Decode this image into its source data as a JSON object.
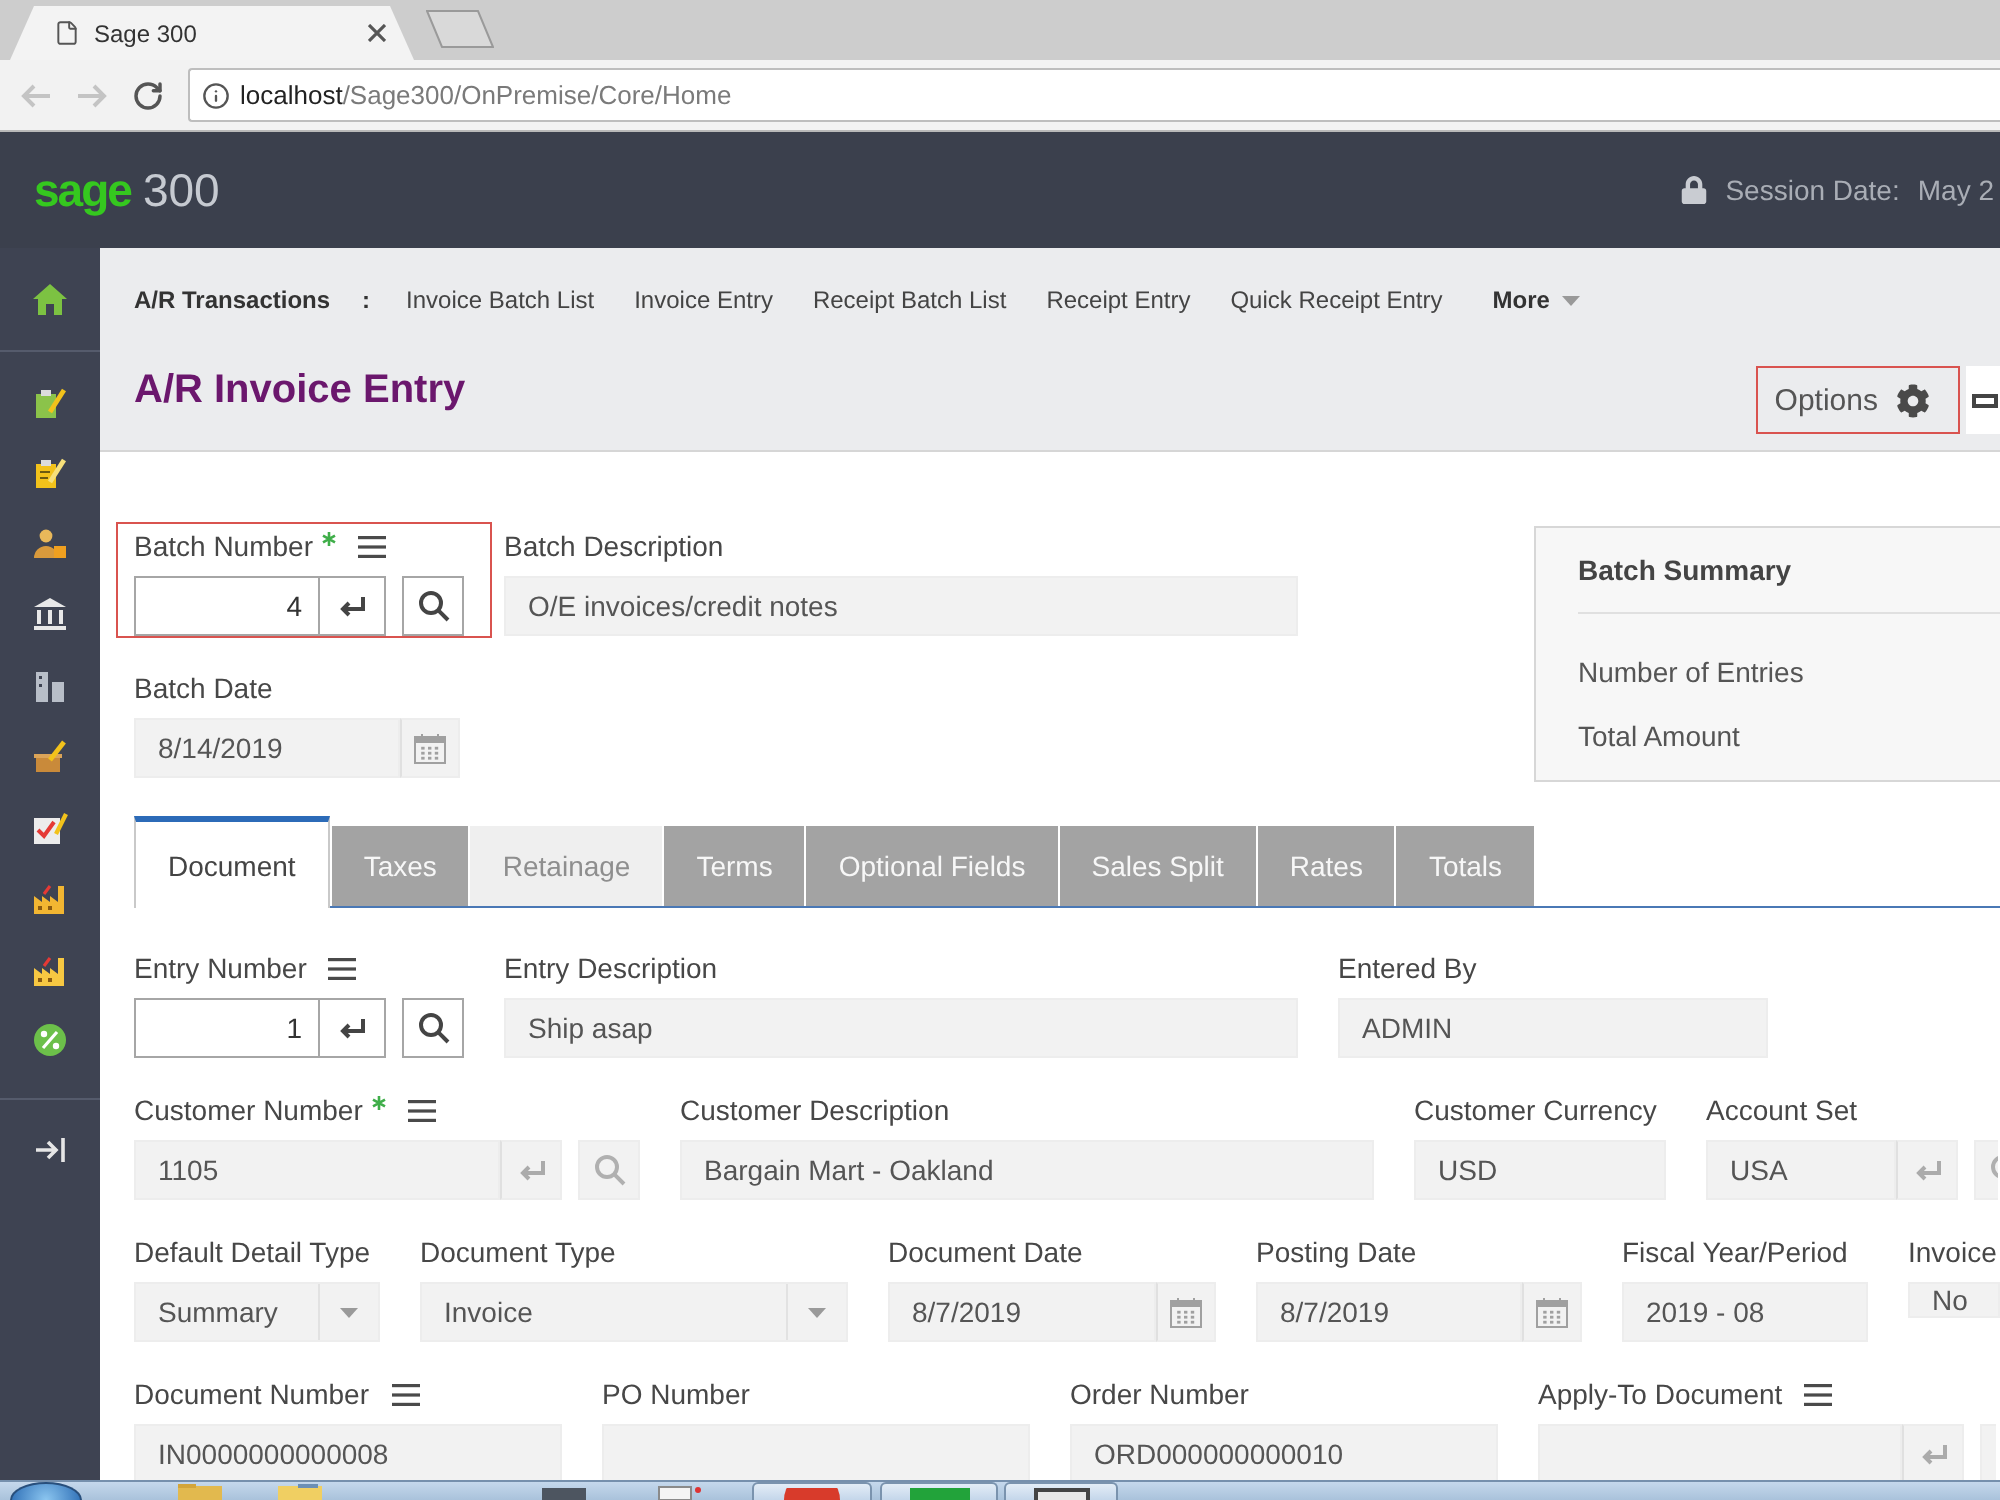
{
  "browser": {
    "tab_title": "Sage 300",
    "back_disabled": true,
    "forward_disabled": true,
    "url_host": "localhost",
    "url_path": "/Sage300/OnPremise/Core/Home"
  },
  "header": {
    "brand": "sage",
    "product": "300",
    "session_label": "Session Date:",
    "session_value": "May 2"
  },
  "breadcrumb": {
    "module": "A/R Transactions",
    "separator": ":",
    "links": [
      "Invoice Batch List",
      "Invoice Entry",
      "Receipt Batch List",
      "Receipt Entry",
      "Quick Receipt Entry"
    ],
    "more": "More"
  },
  "page_title": "A/R Invoice Entry",
  "options_button": {
    "label": "Options",
    "highlighted": true
  },
  "batch": {
    "fields": [
      {
        "kind": "lookup",
        "label": "Batch Number",
        "required": true,
        "menu": true,
        "disabled": false,
        "highlighted": true,
        "value": "4"
      },
      {
        "kind": "text",
        "label": "Batch Description",
        "required": false,
        "menu": false,
        "disabled": true,
        "highlighted": false,
        "value": "O/E invoices/credit notes"
      },
      {
        "kind": "date",
        "label": "Batch Date",
        "required": false,
        "menu": false,
        "disabled": true,
        "highlighted": false,
        "value": "8/14/2019"
      }
    ],
    "summary": {
      "title": "Batch Summary",
      "rows": [
        "Number of Entries",
        "Total Amount"
      ]
    }
  },
  "tabs": [
    {
      "label": "Document",
      "selected": true,
      "disabled": false
    },
    {
      "label": "Taxes",
      "selected": false,
      "disabled": false
    },
    {
      "label": "Retainage",
      "selected": false,
      "disabled": true
    },
    {
      "label": "Terms",
      "selected": false,
      "disabled": false
    },
    {
      "label": "Optional Fields",
      "selected": false,
      "disabled": false
    },
    {
      "label": "Sales Split",
      "selected": false,
      "disabled": false
    },
    {
      "label": "Rates",
      "selected": false,
      "disabled": false
    },
    {
      "label": "Totals",
      "selected": false,
      "disabled": false
    }
  ],
  "document_rows": [
    {
      "fields": [
        {
          "kind": "lookup",
          "label": "Entry Number",
          "required": false,
          "menu": true,
          "disabled": false,
          "value": "1"
        },
        {
          "kind": "text",
          "label": "Entry Description",
          "required": false,
          "menu": false,
          "disabled": true,
          "value": "Ship asap"
        },
        {
          "kind": "text",
          "label": "Entered By",
          "required": false,
          "menu": false,
          "disabled": true,
          "value": "ADMIN"
        }
      ]
    },
    {
      "fields": [
        {
          "kind": "lookup",
          "label": "Customer Number",
          "required": true,
          "menu": true,
          "disabled": true,
          "value": "1105"
        },
        {
          "kind": "text",
          "label": "Customer Description",
          "required": false,
          "menu": false,
          "disabled": true,
          "value": "Bargain Mart - Oakland"
        },
        {
          "kind": "text",
          "label": "Customer Currency",
          "required": false,
          "menu": false,
          "disabled": true,
          "value": "USD"
        },
        {
          "kind": "lookup",
          "label": "Account Set",
          "required": false,
          "menu": false,
          "disabled": true,
          "value": "USA"
        }
      ]
    },
    {
      "fields": [
        {
          "kind": "select",
          "label": "Default Detail Type",
          "required": false,
          "menu": false,
          "disabled": true,
          "value": "Summary"
        },
        {
          "kind": "select",
          "label": "Document Type",
          "required": false,
          "menu": false,
          "disabled": true,
          "value": "Invoice"
        },
        {
          "kind": "date",
          "label": "Document Date",
          "required": false,
          "menu": false,
          "disabled": true,
          "value": "8/7/2019"
        },
        {
          "kind": "date",
          "label": "Posting Date",
          "required": false,
          "menu": false,
          "disabled": true,
          "value": "8/7/2019"
        },
        {
          "kind": "text",
          "label": "Fiscal Year/Period",
          "required": false,
          "menu": false,
          "disabled": true,
          "value": "2019 - 08"
        },
        {
          "kind": "text",
          "label": "Invoice",
          "required": false,
          "menu": false,
          "disabled": true,
          "value": "No"
        }
      ]
    },
    {
      "fields": [
        {
          "kind": "text",
          "label": "Document Number",
          "required": false,
          "menu": true,
          "disabled": true,
          "value": "IN0000000000008"
        },
        {
          "kind": "text",
          "label": "PO Number",
          "required": false,
          "menu": false,
          "disabled": true
        },
        {
          "kind": "text",
          "label": "Order Number",
          "required": false,
          "menu": false,
          "disabled": true,
          "value": "ORD000000000010"
        },
        {
          "kind": "lookup",
          "label": "Apply-To Document",
          "required": false,
          "menu": true,
          "disabled": true
        }
      ]
    }
  ]
}
